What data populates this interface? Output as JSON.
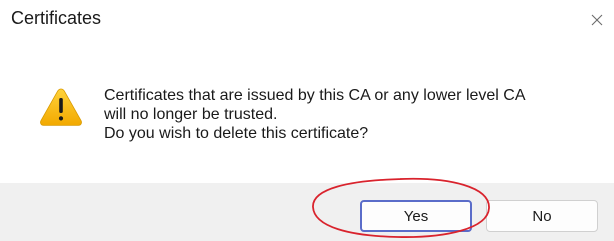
{
  "window": {
    "title": "Certificates",
    "close_icon": "close-icon"
  },
  "message": {
    "icon": "warning-icon",
    "icon_color": "#f4b400",
    "line1": "Certificates that are issued by this CA or any lower level CA",
    "line2": "will no longer be trusted.",
    "line3": "Do you wish to delete this certificate?"
  },
  "buttons": {
    "yes_label": "Yes",
    "no_label": "No",
    "default_border_color": "#5a6cc9"
  },
  "annotation": {
    "shape": "ellipse",
    "target": "yes-button",
    "color": "#d9232d"
  }
}
